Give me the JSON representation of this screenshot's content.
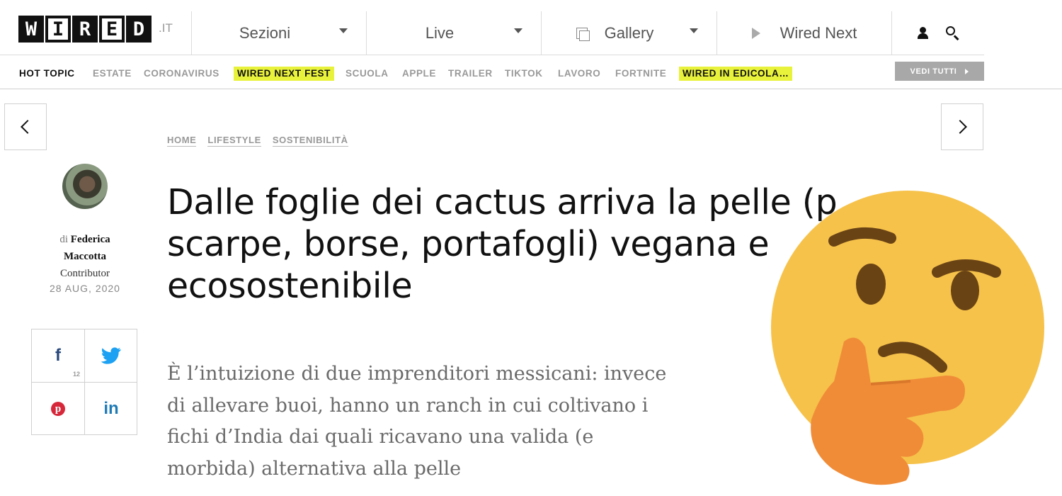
{
  "header": {
    "logo_letters": [
      "W",
      "I",
      "R",
      "E",
      "D"
    ],
    "logo_tld": ".IT",
    "nav": {
      "sezioni": "Sezioni",
      "live": "Live",
      "gallery": "Gallery",
      "wired_next": "Wired Next"
    },
    "icons": [
      "gallery-icon",
      "play-icon",
      "user-icon",
      "search-icon"
    ]
  },
  "topics": {
    "hot_topic": "HOT TOPIC",
    "items": [
      "ESTATE",
      "CORONAVIRUS",
      "WIRED NEXT FEST",
      "SCUOLA",
      "APPLE",
      "TRAILER",
      "TIKTOK",
      "LAVORO",
      "FORTNITE",
      "WIRED IN EDICOLA…"
    ],
    "highlighted": [
      "WIRED NEXT FEST",
      "WIRED IN EDICOLA…"
    ],
    "highlight_color": "#e9f23a",
    "see_all": "VEDI TUTTI"
  },
  "breadcrumb": [
    "HOME",
    "LIFESTYLE",
    "SOSTENIBILITÀ"
  ],
  "author": {
    "prefix": "di",
    "name_line1": "Federica",
    "name_line2": "Maccotta",
    "role": "Contributor",
    "date": "28 AUG, 2020"
  },
  "social": {
    "facebook": "f",
    "facebook_count": "12",
    "pinterest": "p",
    "linkedin": "in"
  },
  "article": {
    "title_line1": "Dalle foglie dei cactus arriva la pelle (p",
    "title_line2": "scarpe, borse, portafogli) vegana e",
    "title_line3": "ecosostenibile",
    "lead_line1": "È l’intuizione di due imprenditori messicani: invece",
    "lead_line2": "di allevare buoi, hanno un ranch in cui coltivano i",
    "lead_line3": "fichi d’India dai quali ricavano una valida (e",
    "lead_line4": "morbida) alternativa alla pelle"
  },
  "overlay": {
    "emoji": "thinking-face-emoji",
    "face_color": "#f6c24a",
    "hand_color": "#f08c38"
  }
}
